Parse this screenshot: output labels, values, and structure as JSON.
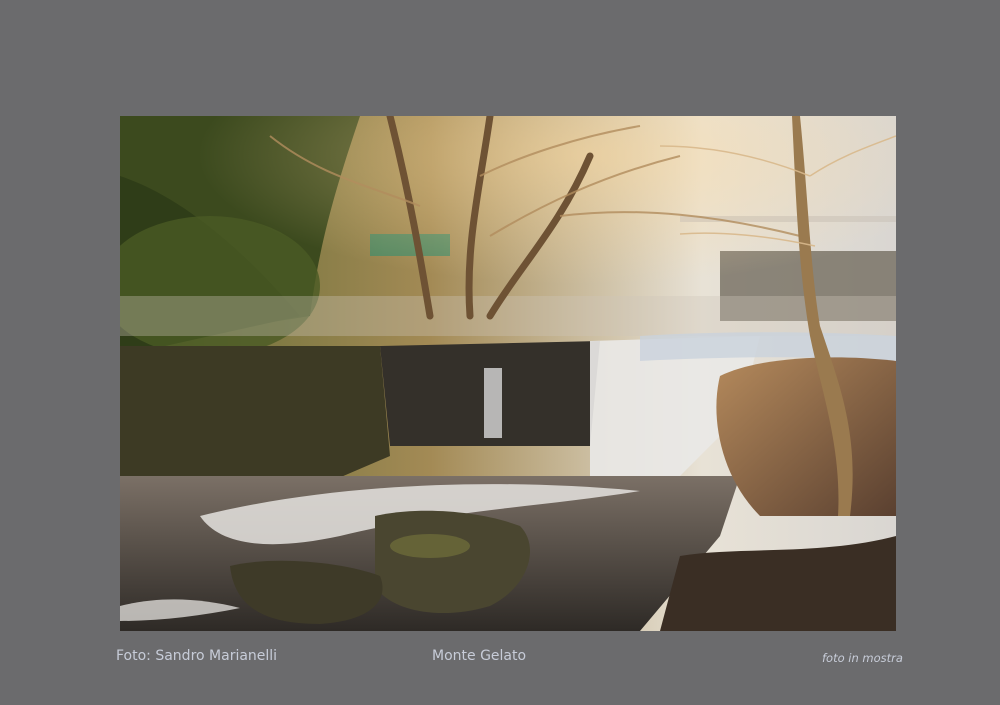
{
  "captions": {
    "credit": "Foto: Sandro Marianelli",
    "title": "Monte Gelato",
    "note": "foto in mostra"
  },
  "colors": {
    "background": "#6b6b6d",
    "caption_text": "#c7ccd8"
  }
}
